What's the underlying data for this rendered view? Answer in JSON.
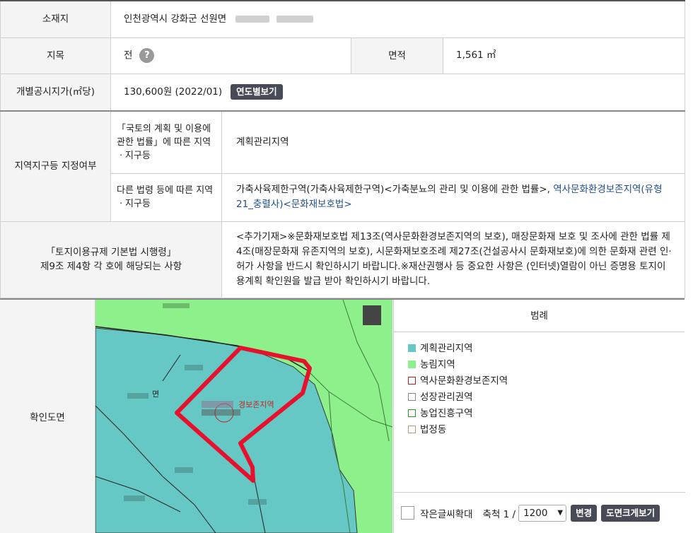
{
  "rows": {
    "location": {
      "label": "소재지",
      "value": "인천광역시 강화군 선원면"
    },
    "landcat": {
      "label": "지목",
      "value": "전",
      "help_icon": "?",
      "area_label": "면적",
      "area_value": "1,561 ㎡"
    },
    "price": {
      "label": "개별공시지가(㎡당)",
      "value": "130,600원 (2022/01)",
      "button": "연도별보기"
    },
    "zone": {
      "label": "지역지구등 지정여부",
      "sub1_label": "「국토의 계획 및 이용에 관한 법률」에 따른 지역ㆍ지구등",
      "sub1_value": "계획관리지역",
      "sub2_label": "다른 법령 등에 따른 지역ㆍ지구등",
      "sub2_value_plain": "가축사육제한구역(가축사육제한구역)<가축분뇨의 관리 및 이용에 관한 법률>, ",
      "sub2_value_link": "역사문화환경보존지역(유형21_충렬사)<문화재보호법>"
    },
    "regulation": {
      "label_line1": "「토지이용규제 기본법 시행령」",
      "label_line2": "제9조 제4항 각 호에 해당되는 사항",
      "value": "<추가기재>※문화재보호법 제13조(역사문화환경보존지역의 보호), 매장문화재 보호 및 조사에 관한 법률 제4조(매장문화재 유존지역의 보호), 시문화재보호조례 제27조(건설공사시 문화재보호)에 의한 문화재 관련 인·허가 사항을 반드시 확인하시기 바랍니다.※재산권행사 등 중요한 사항은 (인터넷)열람이 아닌 증명용 토지이용계획 확인원을 발급 받아 확인하시기 바랍니다."
    },
    "map": {
      "label": "확인도면",
      "map_text": "경보존지역",
      "map_text2": "면"
    }
  },
  "legend": {
    "title": "범례",
    "items": [
      {
        "label": "계획관리지역",
        "color": "#66c8c4",
        "filled": true
      },
      {
        "label": "농림지역",
        "color": "#8ef08a",
        "filled": true
      },
      {
        "label": "역사문화환경보존지역",
        "color": "#b22222",
        "filled": false
      },
      {
        "label": "성장관리권역",
        "color": "#888888",
        "filled": false
      },
      {
        "label": "농업진흥구역",
        "color": "#2a9a2a",
        "filled": false
      },
      {
        "label": "법정동",
        "color": "#b89a7a",
        "filled": false
      }
    ],
    "small_text_label": "작은글씨확대",
    "scale_label": "축척 1 /",
    "scale_value": "1200",
    "change_button": "변경",
    "enlarge_button": "도면크게보기"
  },
  "colors": {
    "plan_zone": "#66c8c4",
    "farm_zone": "#8ef08a",
    "parcel": "#e8112d"
  }
}
